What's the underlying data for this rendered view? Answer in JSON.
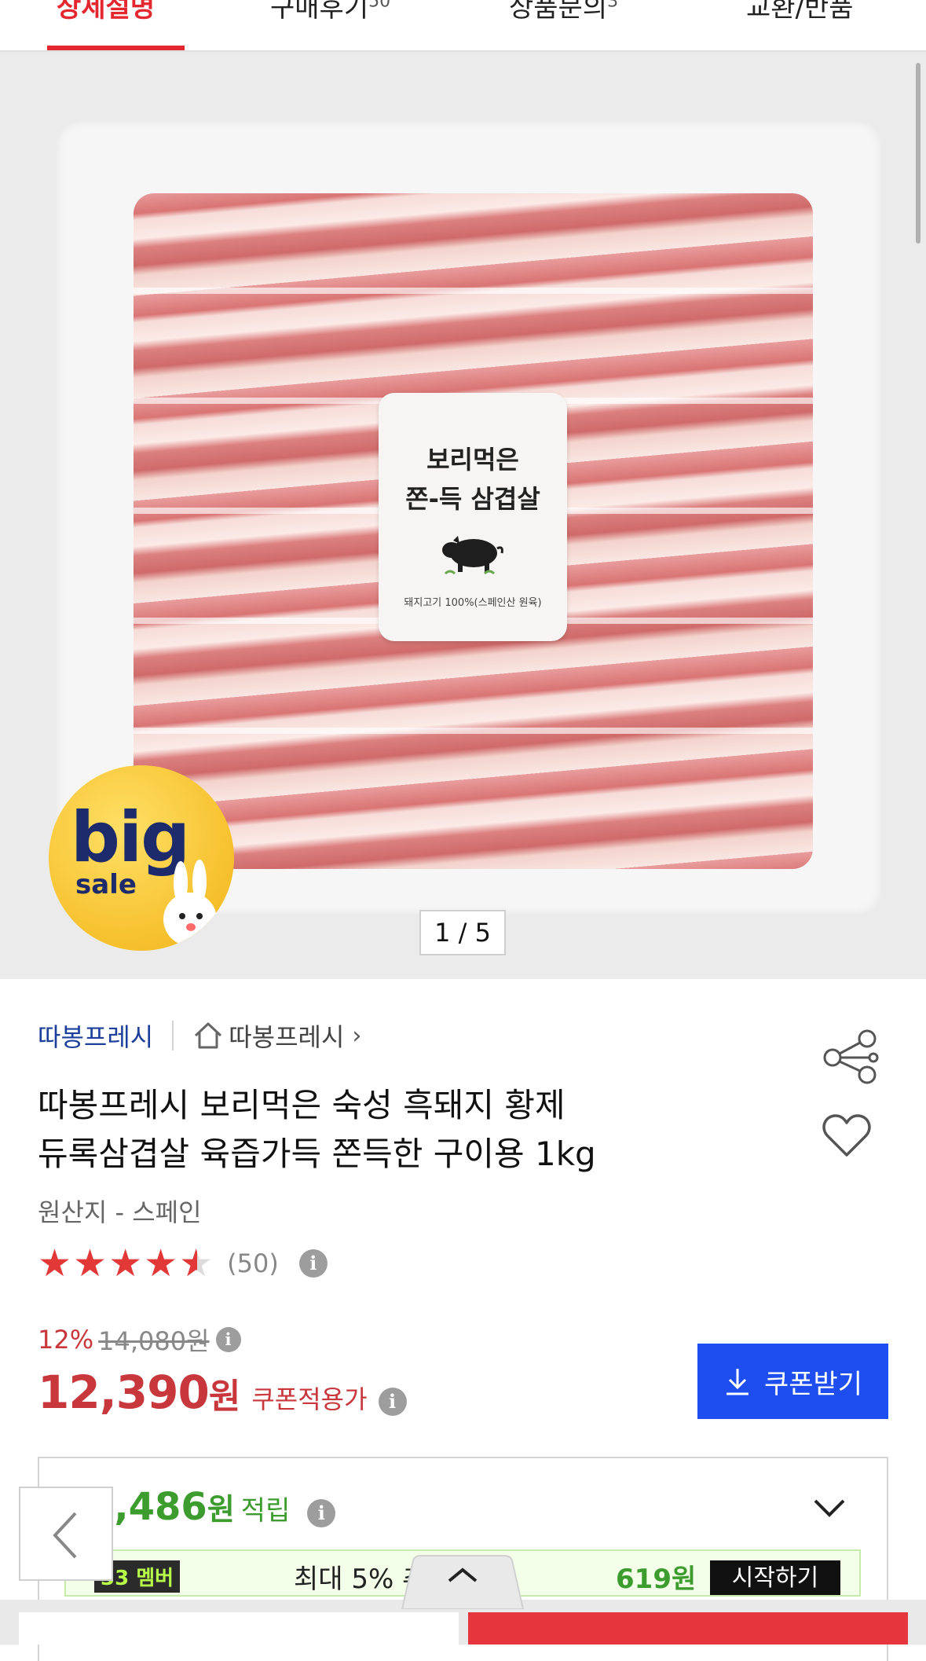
{
  "tabs": [
    {
      "label": "상세설명",
      "count": ""
    },
    {
      "label": "구매후기",
      "count": "50"
    },
    {
      "label": "상품문의",
      "count": "3"
    },
    {
      "label": "교환/반품",
      "count": ""
    }
  ],
  "hero": {
    "label_line1": "보리먹은",
    "label_line2": "쫀-득 삼겹살",
    "label_foot": "돼지고기 100%(스페인산 원육)",
    "badge_big": "big",
    "badge_sale": "sale",
    "counter": "1 / 5"
  },
  "store": {
    "name": "따봉프레시",
    "home_label": "따봉프레시",
    "home_chevron": "›"
  },
  "product": {
    "title_line1": "따봉프레시 보리먹은 숙성 흑돼지 황제",
    "title_line2": "듀록삼겹살 육즙가득 쫀득한 구이용 1kg",
    "origin": "원산지 - 스페인",
    "rating": 4.5,
    "review_count": "(50)"
  },
  "pricing": {
    "discount": "12%",
    "original_price": "14,080원",
    "price": "12,390",
    "price_unit": "원",
    "coupon_applied": "쿠폰적용가",
    "coupon_button": "쿠폰받기"
  },
  "points": {
    "value": "1,486",
    "unit": "원",
    "label": "적립",
    "promo_badge": "33 멤버",
    "promo_text": "최대 5% 추가 적",
    "promo_amount": "619원",
    "promo_cta": "시작하기"
  },
  "icons": {
    "info": "info-icon",
    "share": "share-icon",
    "heart": "heart-icon",
    "home": "home-icon",
    "download": "download-icon",
    "chevron_down": "chevron-down-icon",
    "chevron_up": "chevron-up-icon",
    "chevron_left": "chevron-left-icon"
  },
  "colors": {
    "accent_red": "#e4262e",
    "price_red": "#c8373c",
    "brand_blue": "#1c3f9b",
    "coupon_blue": "#1f4ef0",
    "points_green": "#3c9c2e"
  }
}
